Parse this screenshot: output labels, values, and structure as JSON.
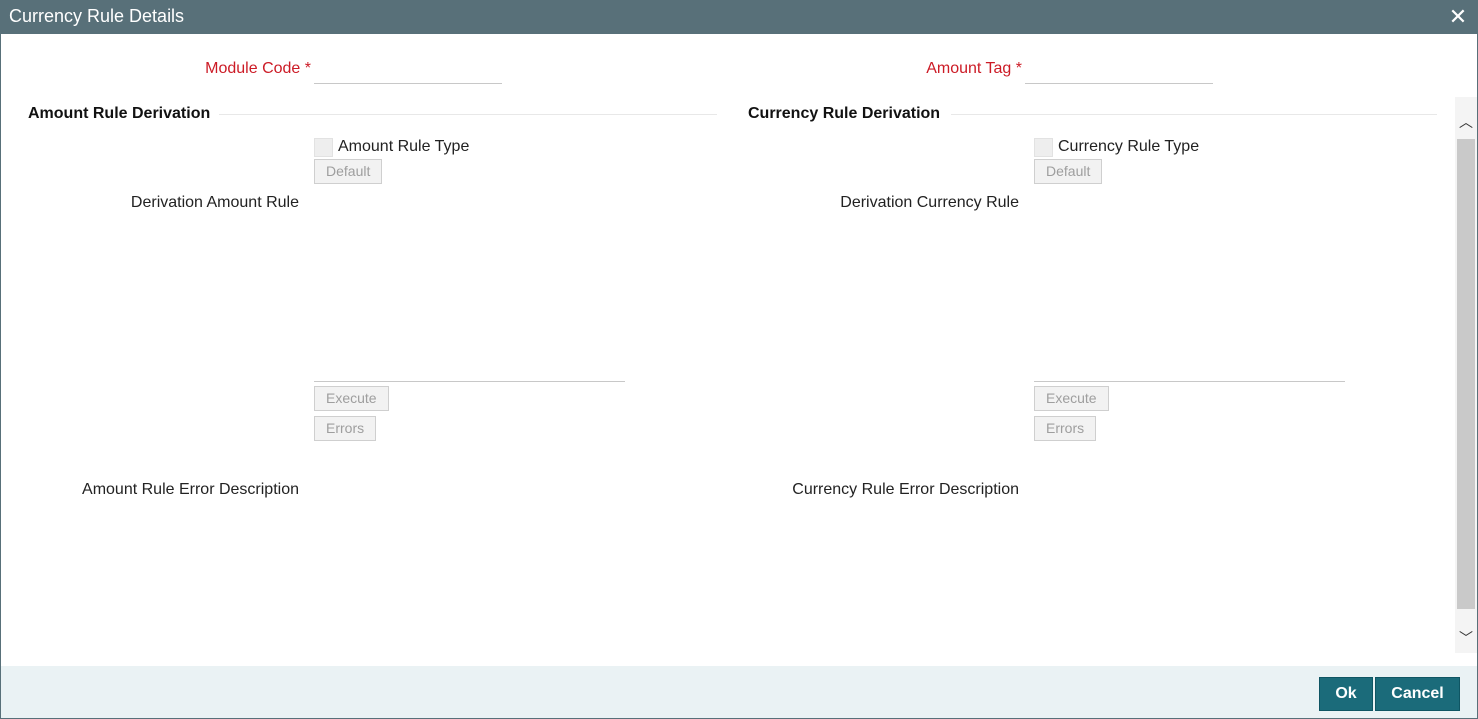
{
  "window": {
    "title": "Currency Rule Details",
    "close_glyph": "✕"
  },
  "header_fields": {
    "module_code_label": "Module Code *",
    "module_code_value": "",
    "amount_tag_label": "Amount Tag *",
    "amount_tag_value": ""
  },
  "amount_section": {
    "title": "Amount Rule Derivation",
    "rule_type_label": "Amount Rule Type",
    "default_label": "Default",
    "derivation_label": "Derivation Amount Rule",
    "execute_label": "Execute",
    "errors_label": "Errors",
    "error_desc_label": "Amount Rule Error Description"
  },
  "currency_section": {
    "title": "Currency Rule Derivation",
    "rule_type_label": "Currency Rule Type",
    "default_label": "Default",
    "derivation_label": "Derivation Currency Rule",
    "execute_label": "Execute",
    "errors_label": "Errors",
    "error_desc_label": "Currency Rule Error Description"
  },
  "scrollbar": {
    "up_glyph": "︿",
    "down_glyph": "﹀"
  },
  "footer": {
    "ok_label": "Ok",
    "cancel_label": "Cancel"
  },
  "colors": {
    "titlebar": "#587079",
    "required": "#cc1b26",
    "primary": "#1b6b7a",
    "footer_bg": "#eaf2f4"
  }
}
